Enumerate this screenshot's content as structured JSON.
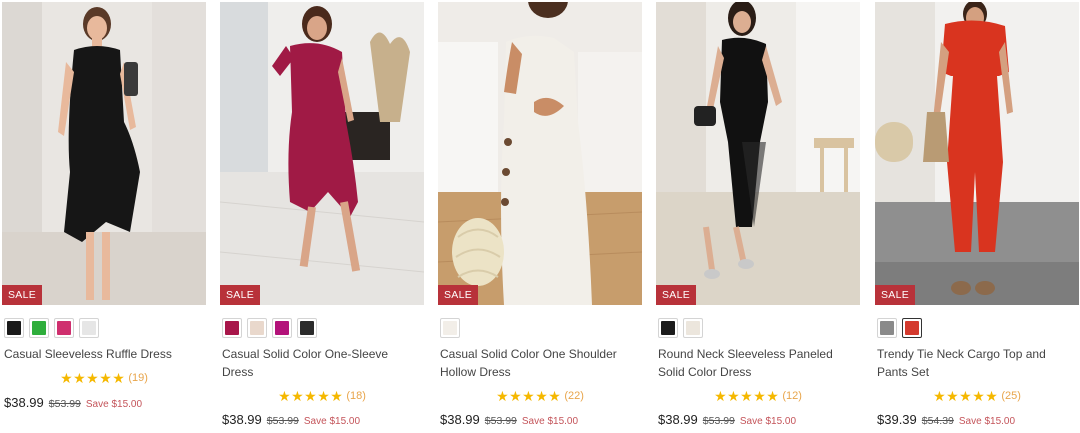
{
  "products": [
    {
      "name": "Casual Sleeveless Ruffle Dress",
      "badge": "SALE",
      "rating_stars": "★★★★★",
      "reviews": "(19)",
      "price": "$38.99",
      "original_price": "$53.99",
      "savings": "Save $15.00",
      "swatches": [
        "#1a1a1a",
        "#2fae3c",
        "#cf2f6e",
        "#e6e6e6"
      ],
      "selected_swatch": -1
    },
    {
      "name": "Casual Solid Color One-Sleeve Dress",
      "badge": "SALE",
      "rating_stars": "★★★★★",
      "reviews": "(18)",
      "price": "$38.99",
      "original_price": "$53.99",
      "savings": "Save $15.00",
      "swatches": [
        "#a8164a",
        "#e9d8cc",
        "#b3127a",
        "#2b2b2b"
      ],
      "selected_swatch": -1
    },
    {
      "name": "Casual Solid Color One Shoulder Hollow Dress",
      "badge": "SALE",
      "rating_stars": "★★★★★",
      "reviews": "(22)",
      "price": "$38.99",
      "original_price": "$53.99",
      "savings": "Save $15.00",
      "swatches": [
        "#f2eee8"
      ],
      "selected_swatch": -1
    },
    {
      "name": "Round Neck Sleeveless Paneled Solid Color Dress",
      "badge": "SALE",
      "rating_stars": "★★★★★",
      "reviews": "(12)",
      "price": "$38.99",
      "original_price": "$53.99",
      "savings": "Save $15.00",
      "swatches": [
        "#1b1b1b",
        "#ece6dd"
      ],
      "selected_swatch": -1
    },
    {
      "name": "Trendy Tie Neck Cargo Top and Pants Set",
      "badge": "SALE",
      "rating_stars": "★★★★★",
      "reviews": "(25)",
      "price": "$39.39",
      "original_price": "$54.39",
      "savings": "Save $15.00",
      "swatches": [
        "#8a8a8a",
        "#d43a2e"
      ],
      "selected_swatch": 1
    }
  ],
  "colors": {
    "sale_badge": "#b8323a",
    "star": "#f5b800",
    "review_count": "#e8a54b",
    "savings": "#c4545a"
  }
}
